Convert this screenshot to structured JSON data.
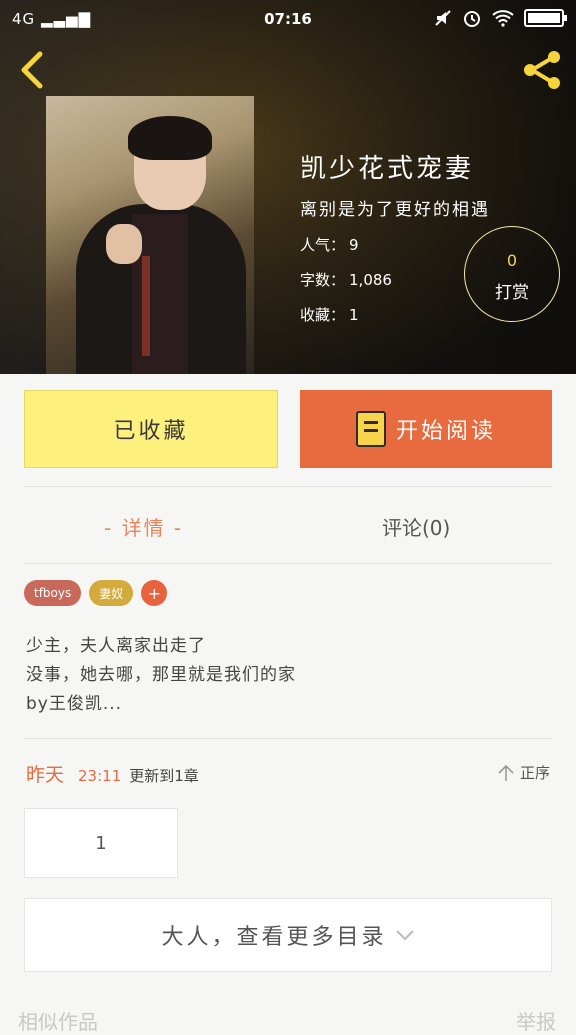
{
  "status_bar": {
    "network": "4G",
    "time": "07:16"
  },
  "book": {
    "title": "凯少花式宠妻",
    "subtitle": "离别是为了更好的相遇",
    "popularity_label": "人气：",
    "popularity": "9",
    "word_count_label": "字数：",
    "word_count": "1,086",
    "favorites_label": "收藏：",
    "favorites": "1"
  },
  "tip": {
    "count": "0",
    "label": "打赏"
  },
  "actions": {
    "favorite_label": "已收藏",
    "read_label": "开始阅读"
  },
  "tabs": {
    "detail": "- 详情 -",
    "comments": "评论(0)"
  },
  "tags": [
    "tfboys",
    "妻奴",
    "+"
  ],
  "description": {
    "line1": "少主，夫人离家出走了",
    "line2": "没事，她去哪，那里就是我们的家",
    "line3": "by王俊凯..."
  },
  "update": {
    "day": "昨天",
    "time": "23:11",
    "text": "更新到1章",
    "order_label": "正序"
  },
  "chapters": [
    "1"
  ],
  "more_catalog": "大人，查看更多目录",
  "footer": {
    "left": "相似作品",
    "right": "举报"
  },
  "colors": {
    "accent_orange": "#e86a3f",
    "favorite_yellow": "#fef07c",
    "tag_red": "#c8695b",
    "tag_gold": "#d3ab3c"
  }
}
